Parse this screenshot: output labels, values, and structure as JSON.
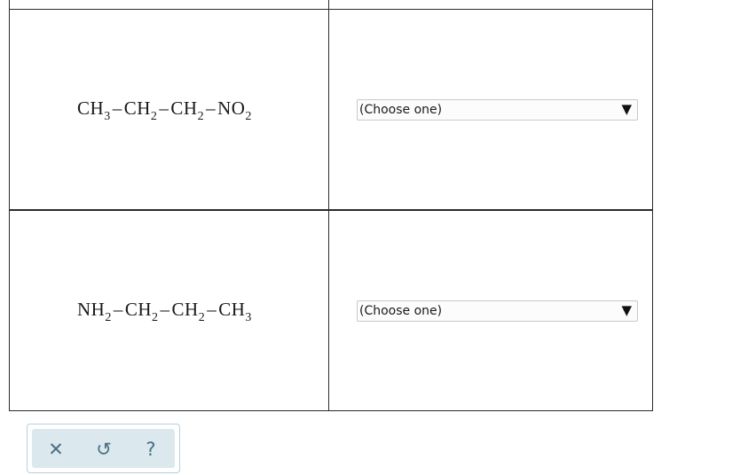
{
  "rows": [
    {
      "formula": {
        "parts": [
          {
            "text": "CH",
            "sub": "3"
          },
          {
            "text": "–"
          },
          {
            "text": "CH",
            "sub": "2"
          },
          {
            "text": "–"
          },
          {
            "text": "CH",
            "sub": "2"
          },
          {
            "text": "–"
          },
          {
            "text": "NO",
            "sub": "2"
          }
        ]
      },
      "select": {
        "selected": "(Choose one)"
      }
    },
    {
      "formula": {
        "parts": [
          {
            "text": "NH",
            "sub": "2"
          },
          {
            "text": "–"
          },
          {
            "text": "CH",
            "sub": "2"
          },
          {
            "text": "–"
          },
          {
            "text": "CH",
            "sub": "2"
          },
          {
            "text": "–"
          },
          {
            "text": "CH",
            "sub": "3"
          }
        ]
      },
      "select": {
        "selected": "(Choose one)"
      }
    }
  ],
  "toolbar": {
    "close_icon": "✕",
    "undo_icon": "↺",
    "help_icon": "?"
  },
  "icons": {
    "dropdown": "▼"
  },
  "colors": {
    "toolbar_bg": "#dbe8ee",
    "toolbar_icon": "#4a6f83",
    "border": "#2b2b2b"
  }
}
